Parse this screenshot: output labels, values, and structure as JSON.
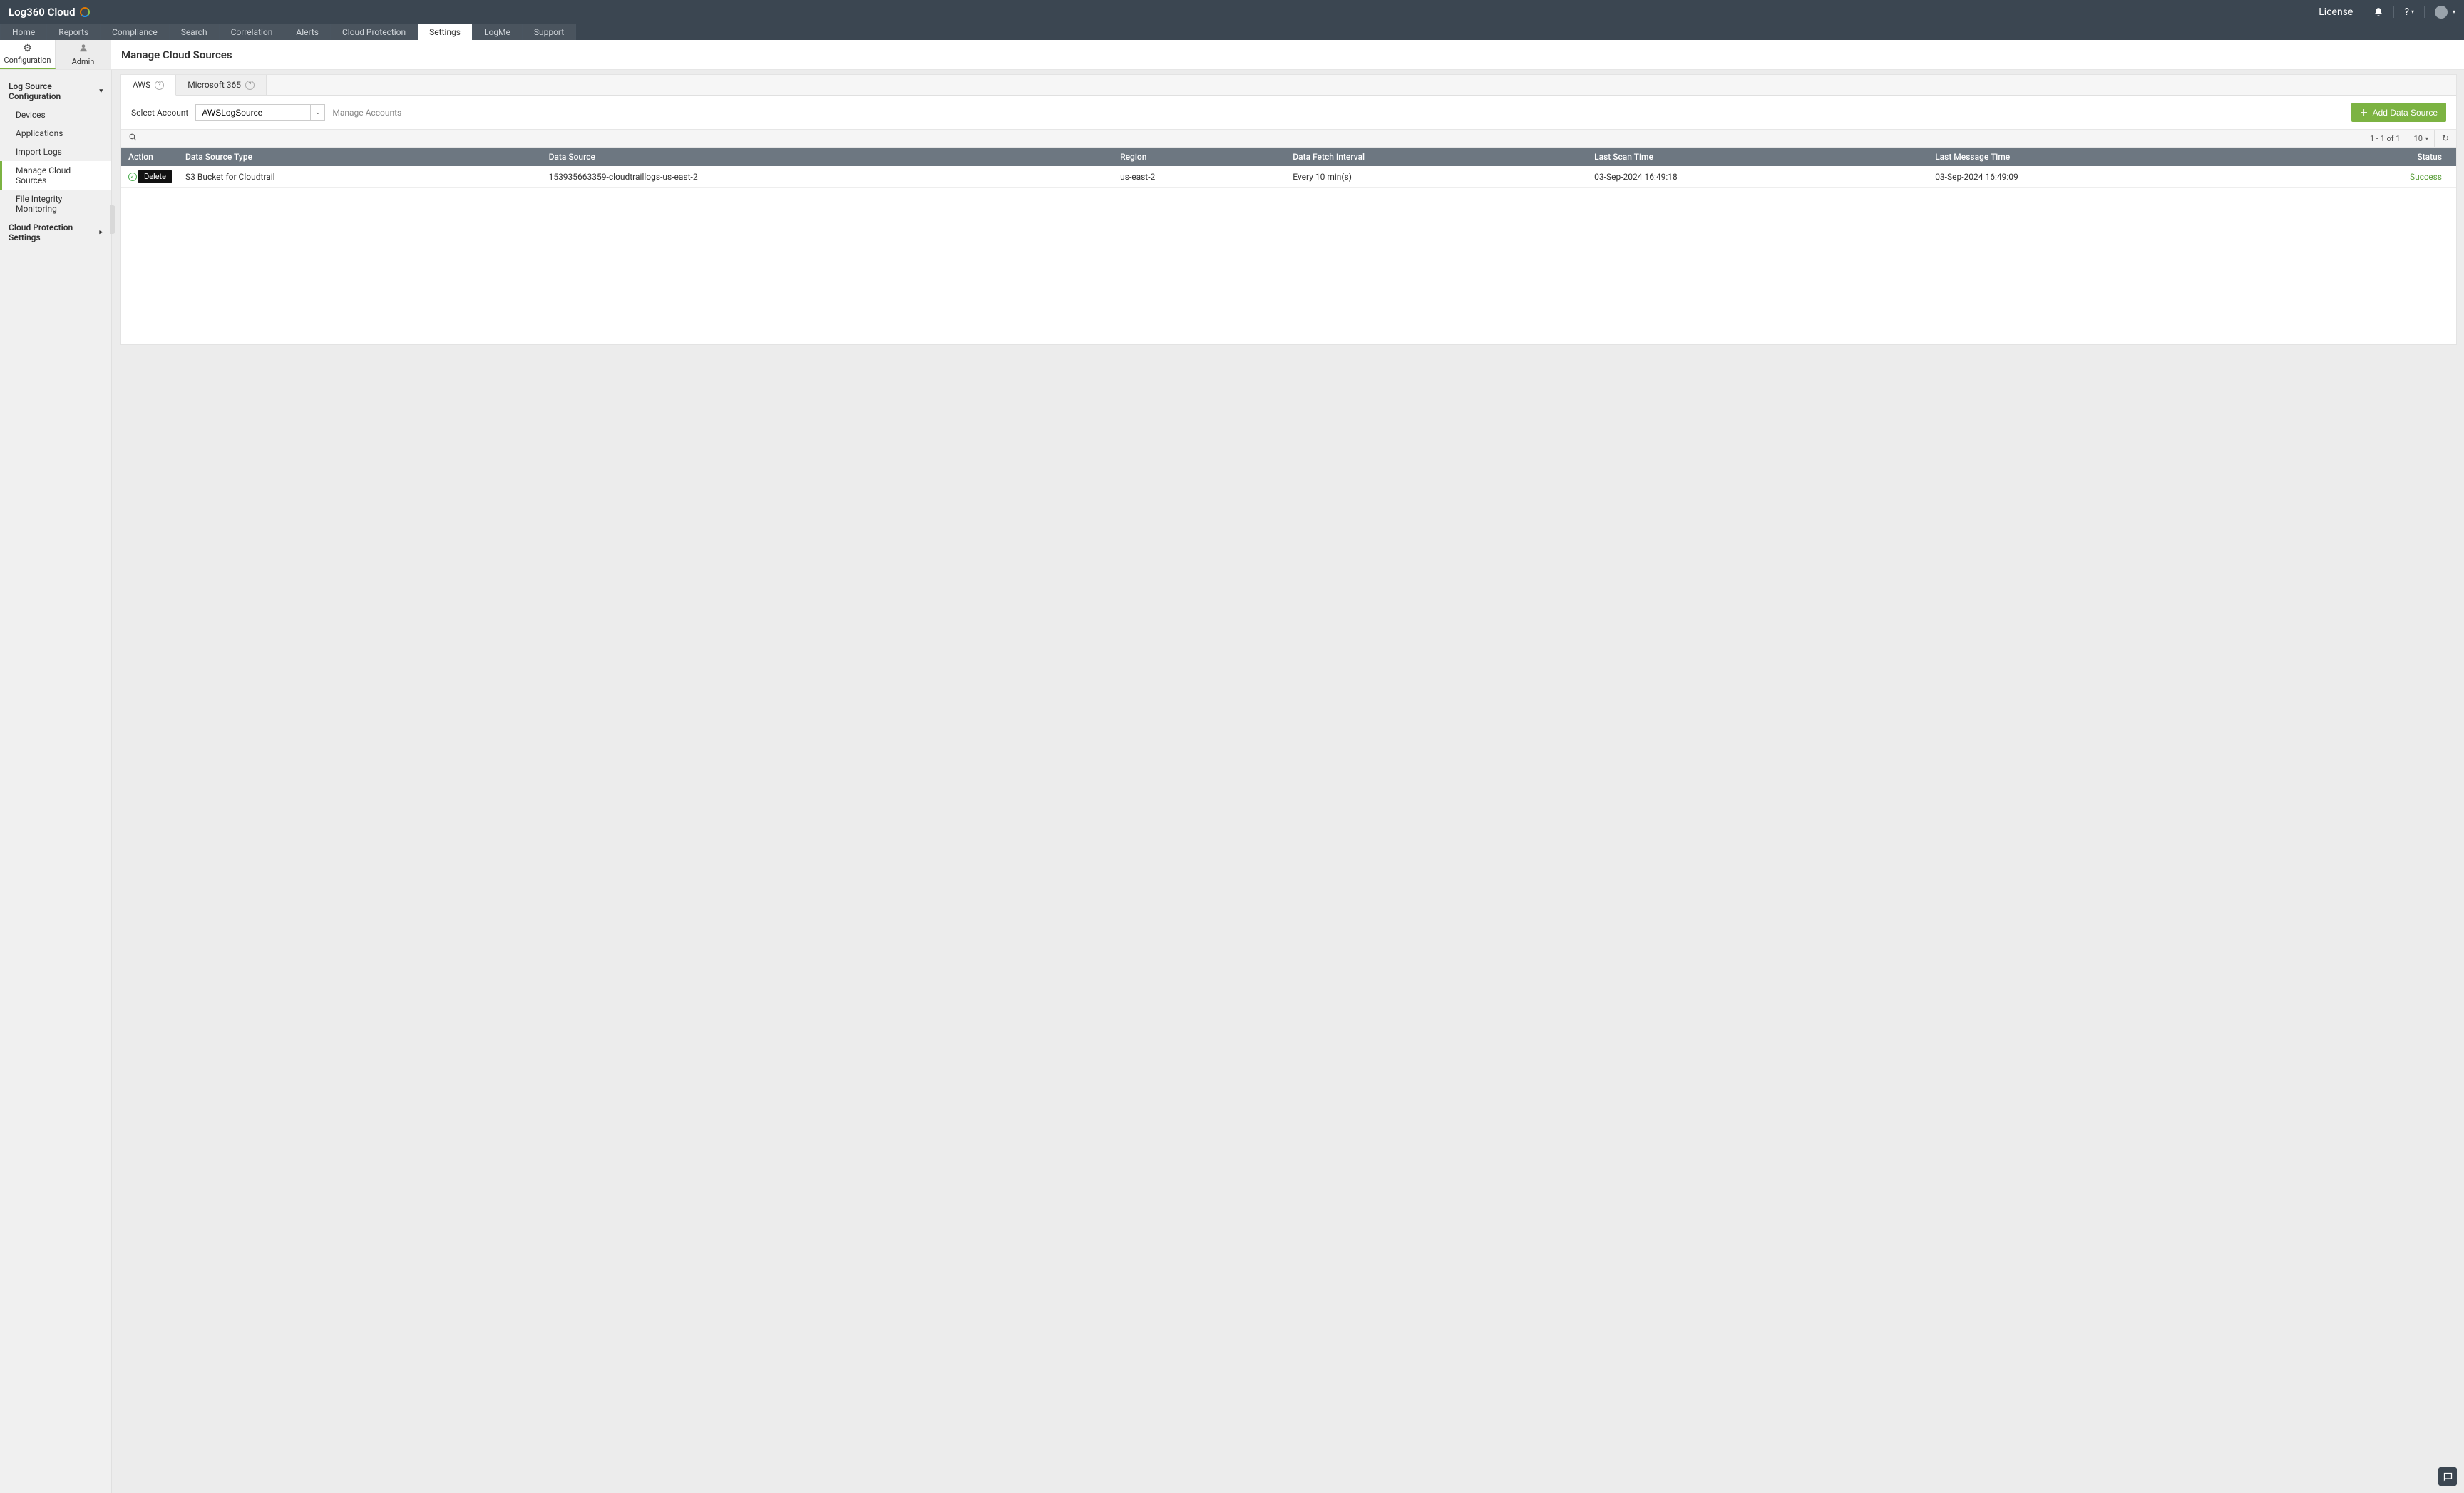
{
  "brand": {
    "name": "Log360 Cloud"
  },
  "topbar": {
    "license_label": "License",
    "help_label": "?",
    "bell_icon": "bell-icon",
    "avatar_icon": "avatar-icon"
  },
  "nav": {
    "items": [
      {
        "label": "Home"
      },
      {
        "label": "Reports"
      },
      {
        "label": "Compliance"
      },
      {
        "label": "Search"
      },
      {
        "label": "Correlation"
      },
      {
        "label": "Alerts"
      },
      {
        "label": "Cloud Protection"
      },
      {
        "label": "Settings",
        "active": true
      },
      {
        "label": "LogMe"
      },
      {
        "label": "Support"
      }
    ]
  },
  "subnav": {
    "items": [
      {
        "label": "Configuration",
        "icon": "gear-icon",
        "active": true
      },
      {
        "label": "Admin",
        "icon": "user-icon"
      }
    ]
  },
  "page_title": "Manage Cloud Sources",
  "sidebar": {
    "sections": [
      {
        "label": "Log Source Configuration",
        "expanded": true,
        "items": [
          {
            "label": "Devices"
          },
          {
            "label": "Applications"
          },
          {
            "label": "Import Logs"
          },
          {
            "label": "Manage Cloud Sources",
            "active": true
          },
          {
            "label": "File Integrity Monitoring"
          }
        ]
      },
      {
        "label": "Cloud Protection Settings",
        "expanded": false,
        "items": []
      }
    ]
  },
  "source_tabs": [
    {
      "label": "AWS",
      "active": true
    },
    {
      "label": "Microsoft 365"
    }
  ],
  "account": {
    "label": "Select Account",
    "selected": "AWSLogSource",
    "manage_link": "Manage Accounts"
  },
  "add_button_label": "Add Data Source",
  "toolbar": {
    "range_text": "1 - 1 of 1",
    "page_size": "10"
  },
  "table": {
    "columns": [
      "Action",
      "Data Source Type",
      "Data Source",
      "Region",
      "Data Fetch Interval",
      "Last Scan Time",
      "Last Message Time",
      "Status"
    ],
    "rows": [
      {
        "data_source_type": "S3 Bucket for Cloudtrail",
        "data_source": "153935663359-cloudtraillogs-us-east-2",
        "region": "us-east-2",
        "interval": "Every 10 min(s)",
        "last_scan": "03-Sep-2024 16:49:18",
        "last_msg": "03-Sep-2024 16:49:09",
        "status": "Success"
      }
    ],
    "tooltip_delete": "Delete"
  }
}
